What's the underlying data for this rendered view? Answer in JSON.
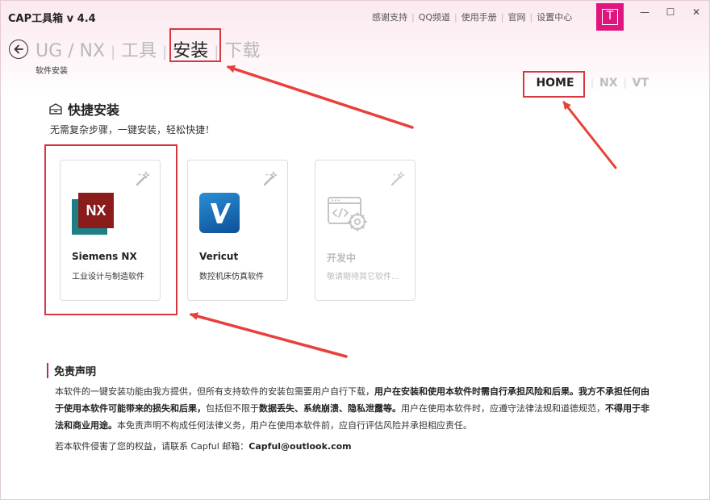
{
  "app": {
    "title": "CAP工具箱 v 4.4"
  },
  "top_links": [
    "感谢支持",
    "QQ频道",
    "使用手册",
    "官网",
    "设置中心"
  ],
  "avatar": {
    "letter": "T",
    "color": "#e0157f"
  },
  "window_controls": {
    "minimize": "—",
    "maximize": "☐",
    "close": "✕"
  },
  "breadcrumb": {
    "items": [
      "UG / NX",
      "工具",
      "安装",
      "下载"
    ],
    "active_index": 2,
    "subtitle": "软件安装"
  },
  "right_nav": {
    "items": [
      "HOME",
      "NX",
      "VT"
    ],
    "active": "HOME"
  },
  "section": {
    "title": "快捷安装",
    "description": "无需复杂步骤，一键安装，轻松快捷！"
  },
  "cards": [
    {
      "name": "Siemens NX",
      "desc": "工业设计与制造软件",
      "icon": "nx-logo",
      "enabled": true
    },
    {
      "name": "Vericut",
      "desc": "数控机床仿真软件",
      "icon": "vericut-logo",
      "enabled": true
    },
    {
      "name": "开发中",
      "desc": "敬请期待其它软件...",
      "icon": "code-gear-icon",
      "enabled": false
    }
  ],
  "disclaimer": {
    "title": "免责声明",
    "p1_a": "本软件的一键安装功能由我方提供，但所有支持软件的安装包需要用户自行下载，",
    "p1_b": "用户在安装和使用本软件时需自行承担风险和后果。我方不承担任何由于使用本软件可能带来的损失和后果，",
    "p1_c": "包括但不限于",
    "p1_d": "数据丢失、系统崩溃、隐私泄露等。",
    "p1_e": "用户在使用本软件时，应遵守法律法规和道德规范，",
    "p1_f": "不得用于非法和商业用途。",
    "p1_g": "本免责声明不构成任何法律义务，用户在使用本软件前，应自行评估风险并承担相应责任。",
    "contact_prefix": "若本软件侵害了您的权益，请联系 Capful 邮箱：",
    "contact_email": "Capful@outlook.com"
  },
  "colors": {
    "accent": "#b02a7d",
    "highlight": "#d9363e",
    "annotation_arrow": "#e8403a"
  }
}
